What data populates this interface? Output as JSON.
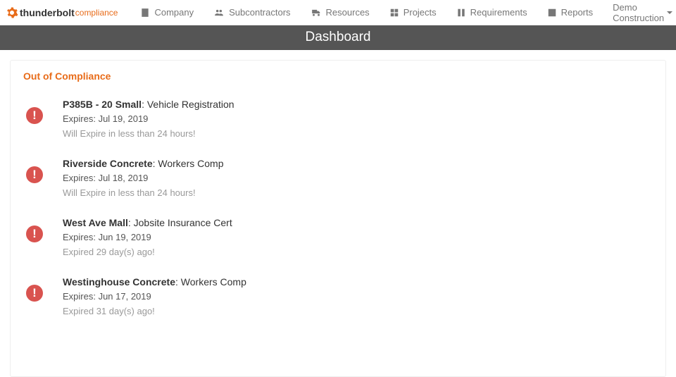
{
  "brand": {
    "text1": "thunderbolt",
    "text2": "compliance"
  },
  "nav": {
    "company": "Company",
    "subcontractors": "Subcontractors",
    "resources": "Resources",
    "projects": "Projects",
    "requirements": "Requirements",
    "reports": "Reports",
    "account": "Demo Construction"
  },
  "titlebar": "Dashboard",
  "section_title": "Out of Compliance",
  "items": [
    {
      "name": "P385B - 20 Small",
      "requirement": "Vehicle Registration",
      "expires": "Expires: Jul 19, 2019",
      "status": "Will Expire in less than 24 hours!"
    },
    {
      "name": "Riverside Concrete",
      "requirement": "Workers Comp",
      "expires": "Expires: Jul 18, 2019",
      "status": "Will Expire in less than 24 hours!"
    },
    {
      "name": "West Ave Mall",
      "requirement": "Jobsite Insurance Cert",
      "expires": "Expires: Jun 19, 2019",
      "status": "Expired 29 day(s) ago!"
    },
    {
      "name": "Westinghouse Concrete",
      "requirement": "Workers Comp",
      "expires": "Expires: Jun 17, 2019",
      "status": "Expired 31 day(s) ago!"
    }
  ]
}
